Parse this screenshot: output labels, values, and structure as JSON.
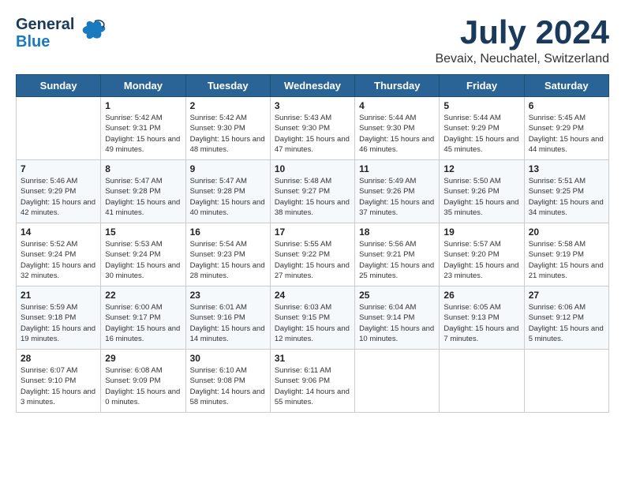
{
  "header": {
    "logo_general": "General",
    "logo_blue": "Blue",
    "month_year": "July 2024",
    "location": "Bevaix, Neuchatel, Switzerland"
  },
  "weekdays": [
    "Sunday",
    "Monday",
    "Tuesday",
    "Wednesday",
    "Thursday",
    "Friday",
    "Saturday"
  ],
  "weeks": [
    [
      {
        "day": "",
        "sunrise": "",
        "sunset": "",
        "daylight": ""
      },
      {
        "day": "1",
        "sunrise": "Sunrise: 5:42 AM",
        "sunset": "Sunset: 9:31 PM",
        "daylight": "Daylight: 15 hours and 49 minutes."
      },
      {
        "day": "2",
        "sunrise": "Sunrise: 5:42 AM",
        "sunset": "Sunset: 9:30 PM",
        "daylight": "Daylight: 15 hours and 48 minutes."
      },
      {
        "day": "3",
        "sunrise": "Sunrise: 5:43 AM",
        "sunset": "Sunset: 9:30 PM",
        "daylight": "Daylight: 15 hours and 47 minutes."
      },
      {
        "day": "4",
        "sunrise": "Sunrise: 5:44 AM",
        "sunset": "Sunset: 9:30 PM",
        "daylight": "Daylight: 15 hours and 46 minutes."
      },
      {
        "day": "5",
        "sunrise": "Sunrise: 5:44 AM",
        "sunset": "Sunset: 9:29 PM",
        "daylight": "Daylight: 15 hours and 45 minutes."
      },
      {
        "day": "6",
        "sunrise": "Sunrise: 5:45 AM",
        "sunset": "Sunset: 9:29 PM",
        "daylight": "Daylight: 15 hours and 44 minutes."
      }
    ],
    [
      {
        "day": "7",
        "sunrise": "Sunrise: 5:46 AM",
        "sunset": "Sunset: 9:29 PM",
        "daylight": "Daylight: 15 hours and 42 minutes."
      },
      {
        "day": "8",
        "sunrise": "Sunrise: 5:47 AM",
        "sunset": "Sunset: 9:28 PM",
        "daylight": "Daylight: 15 hours and 41 minutes."
      },
      {
        "day": "9",
        "sunrise": "Sunrise: 5:47 AM",
        "sunset": "Sunset: 9:28 PM",
        "daylight": "Daylight: 15 hours and 40 minutes."
      },
      {
        "day": "10",
        "sunrise": "Sunrise: 5:48 AM",
        "sunset": "Sunset: 9:27 PM",
        "daylight": "Daylight: 15 hours and 38 minutes."
      },
      {
        "day": "11",
        "sunrise": "Sunrise: 5:49 AM",
        "sunset": "Sunset: 9:26 PM",
        "daylight": "Daylight: 15 hours and 37 minutes."
      },
      {
        "day": "12",
        "sunrise": "Sunrise: 5:50 AM",
        "sunset": "Sunset: 9:26 PM",
        "daylight": "Daylight: 15 hours and 35 minutes."
      },
      {
        "day": "13",
        "sunrise": "Sunrise: 5:51 AM",
        "sunset": "Sunset: 9:25 PM",
        "daylight": "Daylight: 15 hours and 34 minutes."
      }
    ],
    [
      {
        "day": "14",
        "sunrise": "Sunrise: 5:52 AM",
        "sunset": "Sunset: 9:24 PM",
        "daylight": "Daylight: 15 hours and 32 minutes."
      },
      {
        "day": "15",
        "sunrise": "Sunrise: 5:53 AM",
        "sunset": "Sunset: 9:24 PM",
        "daylight": "Daylight: 15 hours and 30 minutes."
      },
      {
        "day": "16",
        "sunrise": "Sunrise: 5:54 AM",
        "sunset": "Sunset: 9:23 PM",
        "daylight": "Daylight: 15 hours and 28 minutes."
      },
      {
        "day": "17",
        "sunrise": "Sunrise: 5:55 AM",
        "sunset": "Sunset: 9:22 PM",
        "daylight": "Daylight: 15 hours and 27 minutes."
      },
      {
        "day": "18",
        "sunrise": "Sunrise: 5:56 AM",
        "sunset": "Sunset: 9:21 PM",
        "daylight": "Daylight: 15 hours and 25 minutes."
      },
      {
        "day": "19",
        "sunrise": "Sunrise: 5:57 AM",
        "sunset": "Sunset: 9:20 PM",
        "daylight": "Daylight: 15 hours and 23 minutes."
      },
      {
        "day": "20",
        "sunrise": "Sunrise: 5:58 AM",
        "sunset": "Sunset: 9:19 PM",
        "daylight": "Daylight: 15 hours and 21 minutes."
      }
    ],
    [
      {
        "day": "21",
        "sunrise": "Sunrise: 5:59 AM",
        "sunset": "Sunset: 9:18 PM",
        "daylight": "Daylight: 15 hours and 19 minutes."
      },
      {
        "day": "22",
        "sunrise": "Sunrise: 6:00 AM",
        "sunset": "Sunset: 9:17 PM",
        "daylight": "Daylight: 15 hours and 16 minutes."
      },
      {
        "day": "23",
        "sunrise": "Sunrise: 6:01 AM",
        "sunset": "Sunset: 9:16 PM",
        "daylight": "Daylight: 15 hours and 14 minutes."
      },
      {
        "day": "24",
        "sunrise": "Sunrise: 6:03 AM",
        "sunset": "Sunset: 9:15 PM",
        "daylight": "Daylight: 15 hours and 12 minutes."
      },
      {
        "day": "25",
        "sunrise": "Sunrise: 6:04 AM",
        "sunset": "Sunset: 9:14 PM",
        "daylight": "Daylight: 15 hours and 10 minutes."
      },
      {
        "day": "26",
        "sunrise": "Sunrise: 6:05 AM",
        "sunset": "Sunset: 9:13 PM",
        "daylight": "Daylight: 15 hours and 7 minutes."
      },
      {
        "day": "27",
        "sunrise": "Sunrise: 6:06 AM",
        "sunset": "Sunset: 9:12 PM",
        "daylight": "Daylight: 15 hours and 5 minutes."
      }
    ],
    [
      {
        "day": "28",
        "sunrise": "Sunrise: 6:07 AM",
        "sunset": "Sunset: 9:10 PM",
        "daylight": "Daylight: 15 hours and 3 minutes."
      },
      {
        "day": "29",
        "sunrise": "Sunrise: 6:08 AM",
        "sunset": "Sunset: 9:09 PM",
        "daylight": "Daylight: 15 hours and 0 minutes."
      },
      {
        "day": "30",
        "sunrise": "Sunrise: 6:10 AM",
        "sunset": "Sunset: 9:08 PM",
        "daylight": "Daylight: 14 hours and 58 minutes."
      },
      {
        "day": "31",
        "sunrise": "Sunrise: 6:11 AM",
        "sunset": "Sunset: 9:06 PM",
        "daylight": "Daylight: 14 hours and 55 minutes."
      },
      {
        "day": "",
        "sunrise": "",
        "sunset": "",
        "daylight": ""
      },
      {
        "day": "",
        "sunrise": "",
        "sunset": "",
        "daylight": ""
      },
      {
        "day": "",
        "sunrise": "",
        "sunset": "",
        "daylight": ""
      }
    ]
  ]
}
